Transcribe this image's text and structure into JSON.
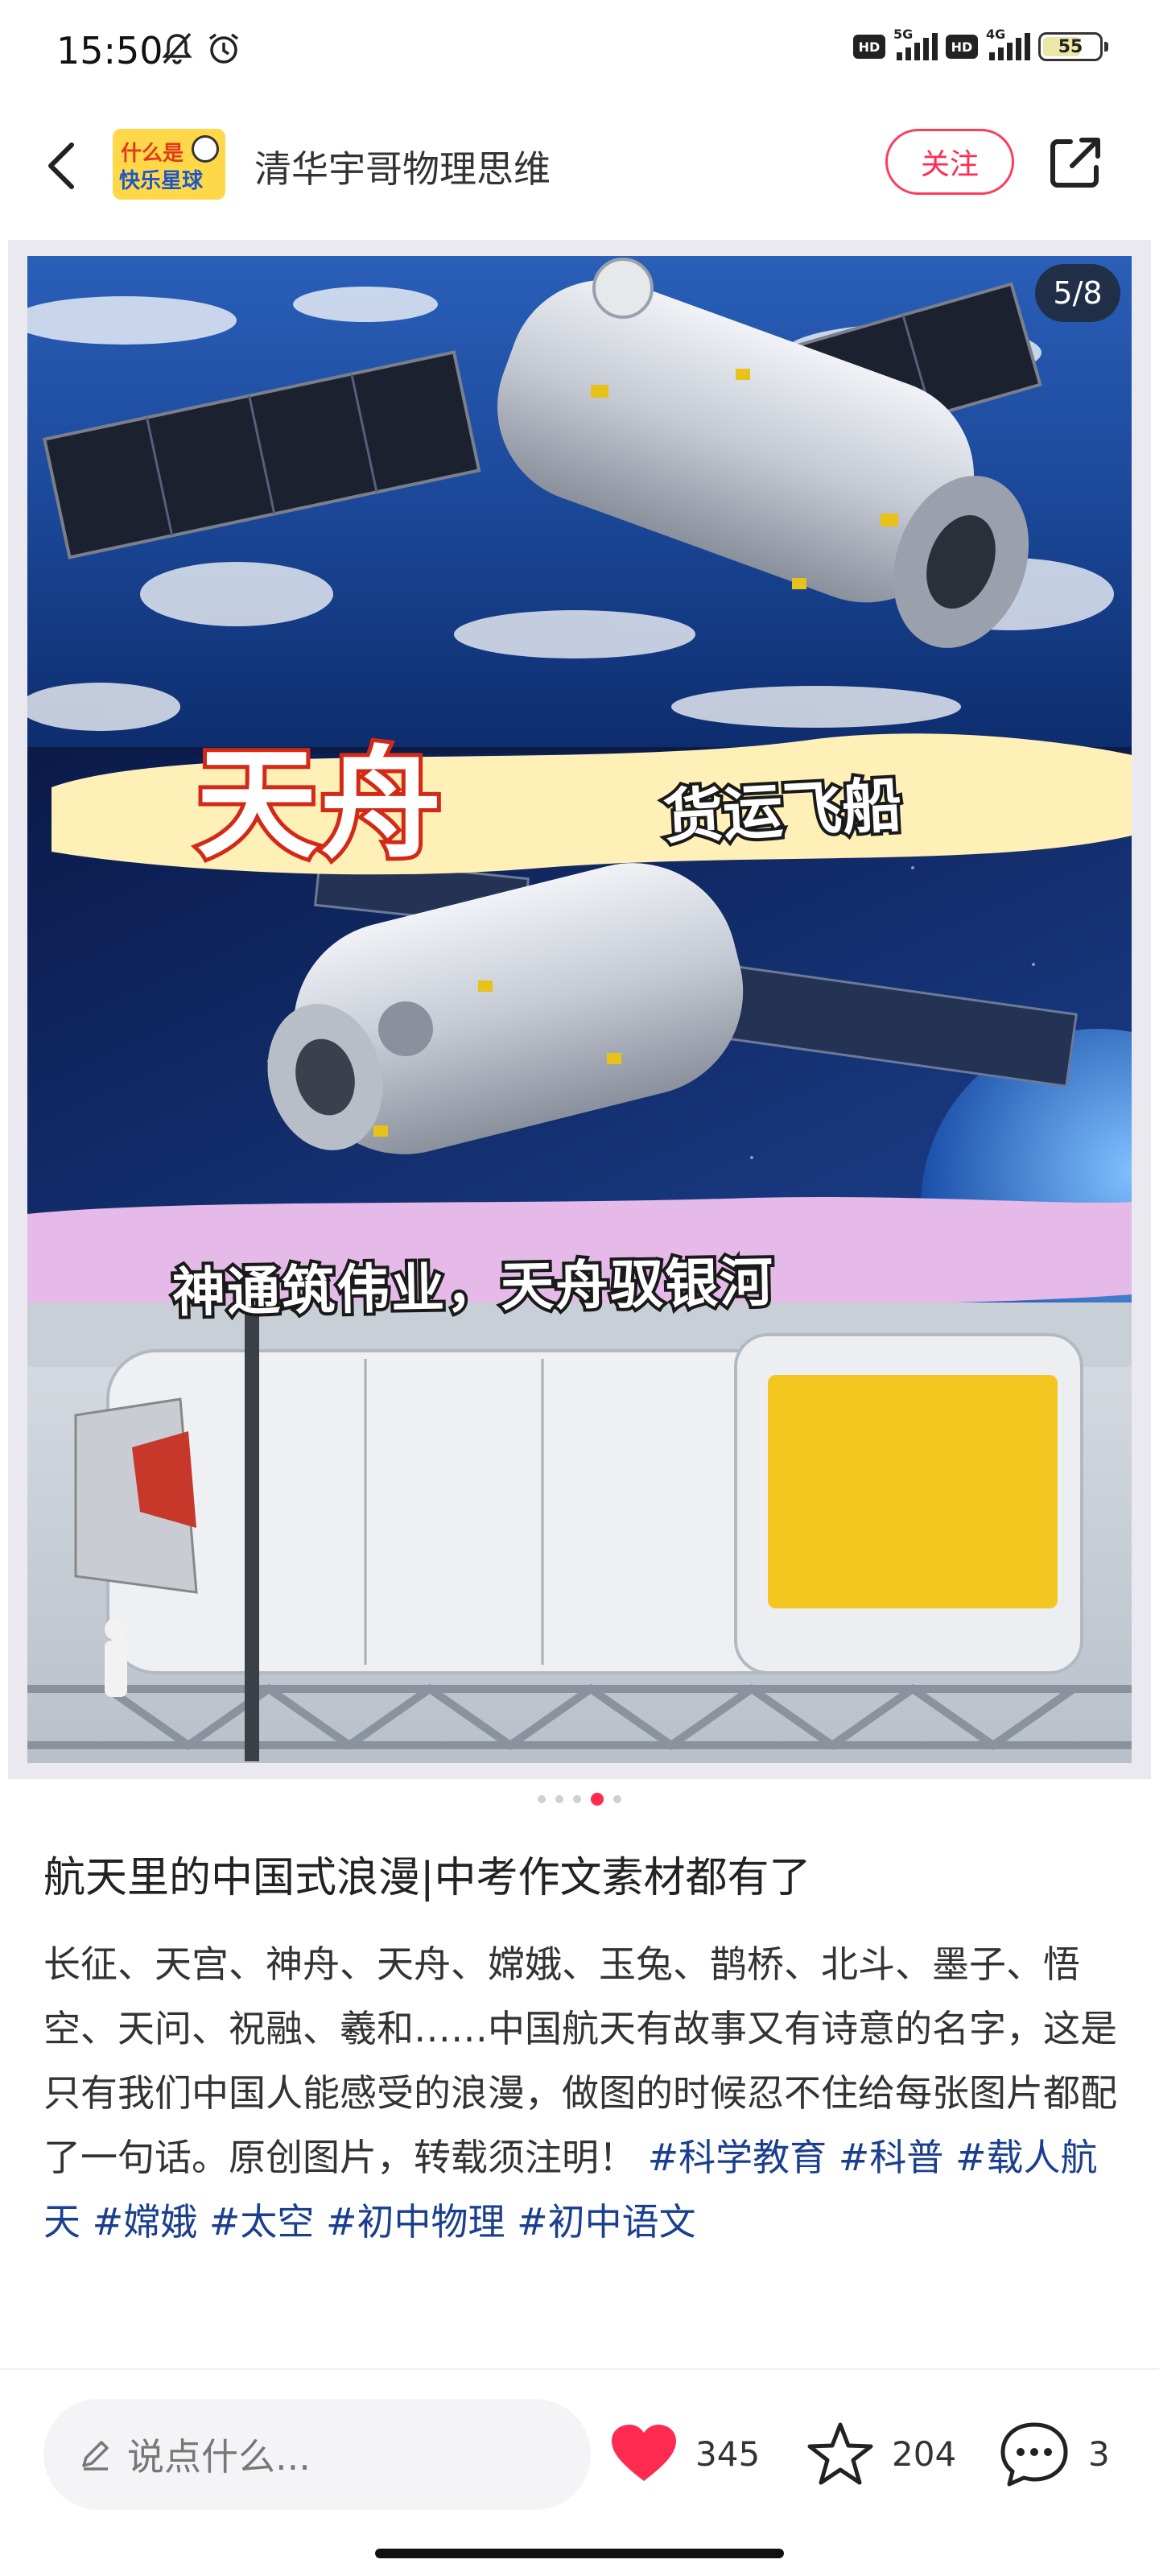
{
  "status_bar": {
    "time": "15:50",
    "network_1": "5G",
    "network_2": "4G",
    "hd_label": "HD",
    "battery": "55"
  },
  "header": {
    "account_name": "清华宇哥物理思维",
    "avatar_line1": "什么是",
    "avatar_line2": "快乐星球",
    "follow_label": "关注"
  },
  "carousel": {
    "page_indicator": "5/8",
    "current_index": 4,
    "total_dots": 5,
    "poster_title": "天舟",
    "poster_subtitle": "货运飞船",
    "poster_slogan": "神通筑伟业，天舟驭银河"
  },
  "post": {
    "title": "航天里的中国式浪漫|中考作文素材都有了",
    "body": "长征、天宫、神舟、天舟、嫦娥、玉兔、鹊桥、北斗、墨子、悟空、天问、祝融、羲和……中国航天有故事又有诗意的名字，这是只有我们中国人能感受的浪漫，做图的时候忍不住给每张图片都配了一句话。原创图片，转载须注明！",
    "tags": [
      "#科学教育",
      "#科普",
      "#载人航天",
      "#嫦娥",
      "#太空",
      "#初中物理",
      "#初中语文"
    ]
  },
  "bottom_bar": {
    "comment_placeholder": "说点什么...",
    "likes": "345",
    "favorites": "204",
    "comments": "3"
  },
  "colors": {
    "accent": "#ff2a4f",
    "tag": "#1b3f8f",
    "poster_title_stroke": "#d32916"
  }
}
